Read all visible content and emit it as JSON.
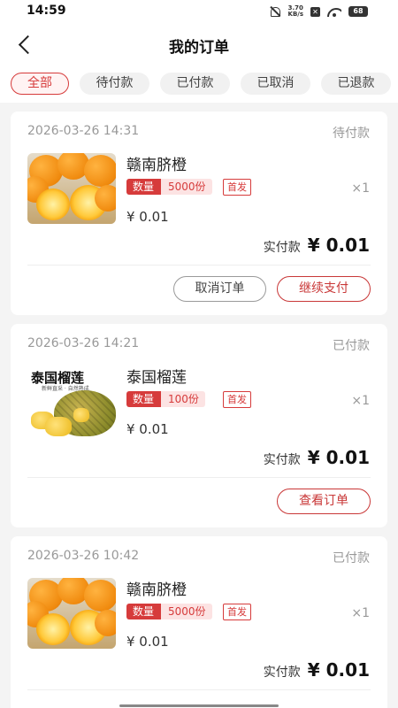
{
  "status_bar": {
    "time": "14:59",
    "speed_top": "3.70",
    "speed_bottom": "KB/s",
    "battery": "68"
  },
  "nav": {
    "title": "我的订单"
  },
  "tabs": [
    {
      "label": "全部",
      "active": true
    },
    {
      "label": "待付款",
      "active": false
    },
    {
      "label": "已付款",
      "active": false
    },
    {
      "label": "已取消",
      "active": false
    },
    {
      "label": "已退款",
      "active": false
    }
  ],
  "orders": [
    {
      "date": "2026-03-26 14:31",
      "status": "待付款",
      "product_name": "赣南脐橙",
      "image": "navel-orange",
      "qty_label": "数量",
      "qty_value": "5000份",
      "badge": "首发",
      "count": "×1",
      "unit_price": "¥ 0.01",
      "paid_label": "实付款",
      "paid_amount": "¥ 0.01",
      "buttons": [
        "取消订单",
        "继续支付"
      ]
    },
    {
      "date": "2026-03-26 14:21",
      "status": "已付款",
      "product_name": "泰国榴莲",
      "image": "durian",
      "image_title": "泰国榴莲",
      "image_subtitle": "新鲜直采 · 自然熟成",
      "qty_label": "数量",
      "qty_value": "100份",
      "badge": "首发",
      "count": "×1",
      "unit_price": "¥ 0.01",
      "paid_label": "实付款",
      "paid_amount": "¥ 0.01",
      "buttons": [
        "查看订单"
      ]
    },
    {
      "date": "2026-03-26 10:42",
      "status": "已付款",
      "product_name": "赣南脐橙",
      "image": "navel-orange",
      "qty_label": "数量",
      "qty_value": "5000份",
      "badge": "首发",
      "count": "×1",
      "unit_price": "¥ 0.01",
      "paid_label": "实付款",
      "paid_amount": "¥ 0.01",
      "buttons": []
    }
  ],
  "colors": {
    "accent": "#d63b3b",
    "background": "#f4f4f4",
    "muted": "#999999"
  }
}
